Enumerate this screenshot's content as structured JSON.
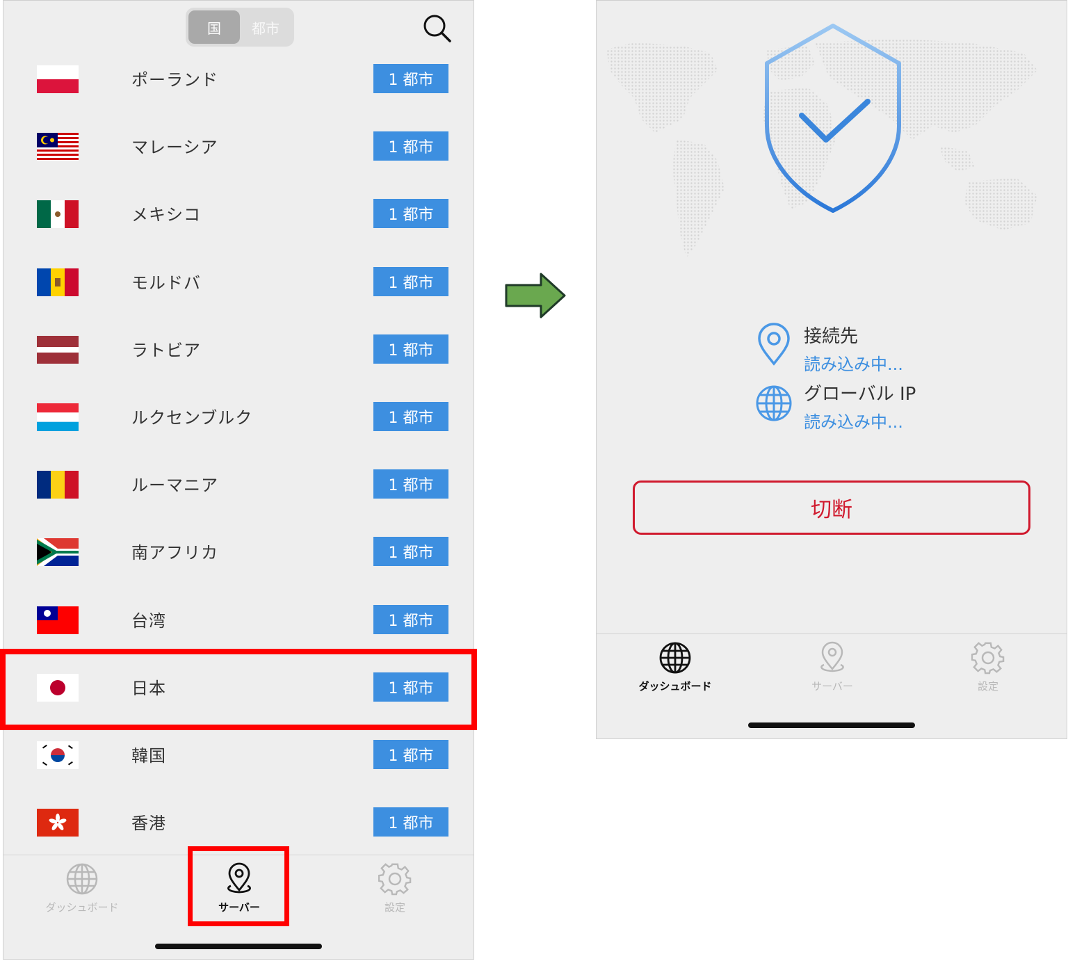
{
  "left_screen": {
    "segment": {
      "country": "国",
      "city": "都市"
    },
    "countries": [
      {
        "name": "ポーランド",
        "flag": "poland-flag-icon",
        "cities": "1 都市"
      },
      {
        "name": "マレーシア",
        "flag": "malaysia-flag-icon",
        "cities": "1 都市"
      },
      {
        "name": "メキシコ",
        "flag": "mexico-flag-icon",
        "cities": "1 都市"
      },
      {
        "name": "モルドバ",
        "flag": "moldova-flag-icon",
        "cities": "1 都市"
      },
      {
        "name": "ラトビア",
        "flag": "latvia-flag-icon",
        "cities": "1 都市"
      },
      {
        "name": "ルクセンブルク",
        "flag": "luxembourg-flag-icon",
        "cities": "1 都市"
      },
      {
        "name": "ルーマニア",
        "flag": "romania-flag-icon",
        "cities": "1 都市"
      },
      {
        "name": "南アフリカ",
        "flag": "south-africa-flag-icon",
        "cities": "1 都市"
      },
      {
        "name": "台湾",
        "flag": "taiwan-flag-icon",
        "cities": "1 都市"
      },
      {
        "name": "日本",
        "flag": "japan-flag-icon",
        "cities": "1 都市"
      },
      {
        "name": "韓国",
        "flag": "korea-flag-icon",
        "cities": "1 都市"
      },
      {
        "name": "香港",
        "flag": "hong-kong-flag-icon",
        "cities": "1 都市"
      }
    ],
    "tabs": {
      "dashboard": "ダッシュボード",
      "server": "サーバー",
      "settings": "設定"
    }
  },
  "right_screen": {
    "connection": {
      "label": "接続先",
      "value": "読み込み中..."
    },
    "global_ip": {
      "label": "グローバル IP",
      "value": "読み込み中..."
    },
    "disconnect_label": "切断",
    "tabs": {
      "dashboard": "ダッシュボード",
      "server": "サーバー",
      "settings": "設定"
    }
  },
  "colors": {
    "accent_blue": "#3d8fe0",
    "highlight_red": "#ff0000",
    "disconnect_red": "#d0192d",
    "arrow_green": "#6aa84f"
  }
}
